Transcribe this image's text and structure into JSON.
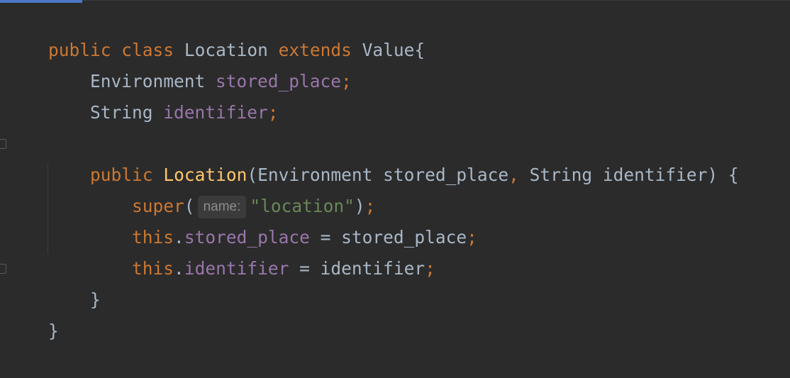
{
  "editor": {
    "language": "java",
    "theme": {
      "background": "#2b2b2b",
      "keyword": "#cc7832",
      "field": "#9876aa",
      "string": "#6a8759",
      "method_decl": "#ffc66d",
      "text": "#a9b7c6"
    },
    "lines": [
      {
        "tokens": [
          "public",
          " ",
          "class",
          " Location ",
          "extends",
          " Value{"
        ]
      },
      {
        "tokens": [
          "    Environment ",
          "stored_place",
          ";"
        ]
      },
      {
        "tokens": [
          "    String ",
          "identifier",
          ";"
        ]
      },
      {
        "tokens": []
      },
      {
        "tokens": [
          "    ",
          "public",
          " ",
          "Location",
          "(Environment stored_place",
          ",",
          " String identifier) {"
        ]
      },
      {
        "tokens": [
          "        ",
          "super",
          "(",
          "name:",
          "\"location\"",
          ")",
          ";"
        ]
      },
      {
        "tokens": [
          "        ",
          "this",
          ".",
          "stored_place",
          " = stored_place",
          ";"
        ]
      },
      {
        "tokens": [
          "        ",
          "this",
          ".",
          "identifier",
          " = identifier",
          ";"
        ]
      },
      {
        "tokens": [
          "    }"
        ]
      },
      {
        "tokens": [
          "}"
        ]
      }
    ],
    "fold_icons": [
      "fold-marker-constructor-start",
      "fold-marker-constructor-end"
    ]
  }
}
